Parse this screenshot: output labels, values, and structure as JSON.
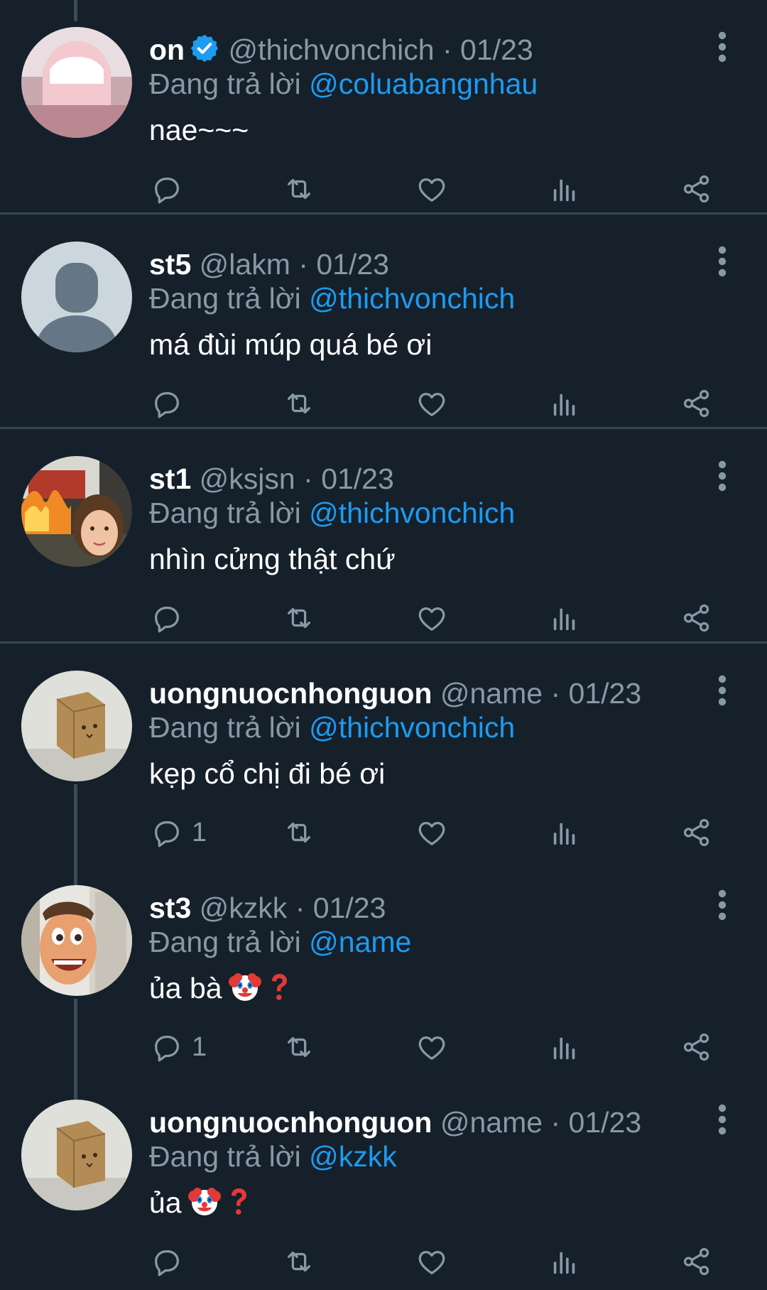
{
  "tweets": [
    {
      "name": "on",
      "verified": true,
      "handle": "@thichvonchich",
      "dot": "·",
      "date": "01/23",
      "replying_prefix": "Đang trả lời ",
      "replying_to": "@coluabangnhau",
      "text": "nae~~~",
      "reply_count": "",
      "avatar": "pink-legs-photo"
    },
    {
      "name": "st5",
      "verified": false,
      "handle": "@lakm",
      "dot": "·",
      "date": "01/23",
      "replying_prefix": "Đang trả lời ",
      "replying_to": "@thichvonchich",
      "text": "má đùi múp quá bé ơi",
      "reply_count": "",
      "avatar": "default-user-silhouette"
    },
    {
      "name": "st1",
      "verified": false,
      "handle": "@ksjsn",
      "dot": "·",
      "date": "01/23",
      "replying_prefix": "Đang trả lời ",
      "replying_to": "@thichvonchich",
      "text": "nhìn cửng thật chứ",
      "reply_count": "",
      "avatar": "disaster-girl-fire-photo"
    },
    {
      "name": "uongnuocnhonguon",
      "verified": false,
      "handle": "@name",
      "dot": "·",
      "date": "01/23",
      "replying_prefix": "Đang trả lời ",
      "replying_to": "@thichvonchich",
      "text": "kẹp cổ chị đi bé ơi",
      "reply_count": "1",
      "avatar": "paper-bag-box-photo"
    },
    {
      "name": "st3",
      "verified": false,
      "handle": "@kzkk",
      "dot": "·",
      "date": "01/23",
      "replying_prefix": "Đang trả lời ",
      "replying_to": "@name",
      "text": "ủa bà",
      "emoji": [
        "clown-face",
        "red-question-mark"
      ],
      "reply_count": "1",
      "avatar": "cartoon-face-photo"
    },
    {
      "name": "uongnuocnhonguon",
      "verified": false,
      "handle": "@name",
      "dot": "·",
      "date": "01/23",
      "replying_prefix": "Đang trả lời ",
      "replying_to": "@kzkk",
      "text": "ủa",
      "emoji": [
        "clown-face",
        "red-question-mark"
      ],
      "reply_count": "",
      "avatar": "paper-bag-box-photo"
    }
  ],
  "action_icons": [
    "reply-icon",
    "retweet-icon",
    "like-icon",
    "views-icon",
    "share-icon"
  ],
  "colors": {
    "background": "#15202b",
    "divider": "#38444d",
    "secondary_text": "#8899a6",
    "mention": "#1d9bf0",
    "verified": "#1d9bf0"
  }
}
